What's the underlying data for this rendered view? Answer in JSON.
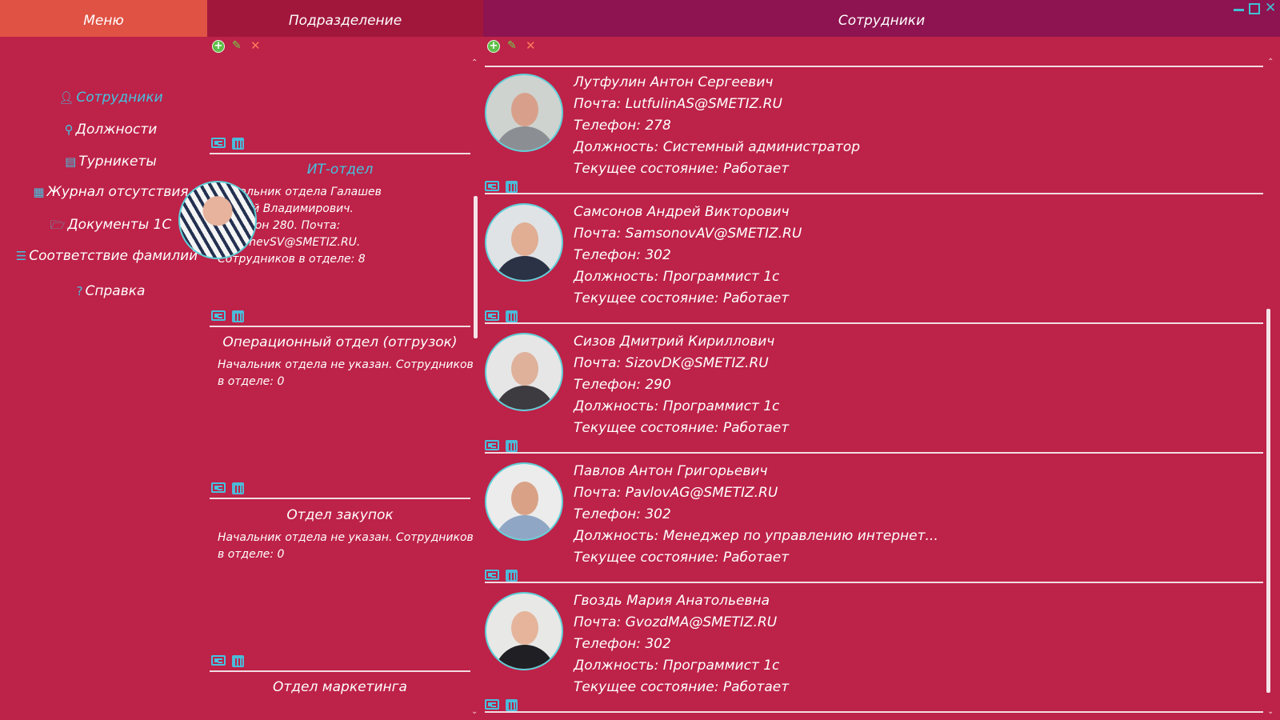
{
  "header": {
    "menu_title": "Меню",
    "dept_title": "Подразделение",
    "emp_title": "Сотрудники"
  },
  "menu": {
    "items": [
      {
        "label": "Сотрудники",
        "icon": "user-icon",
        "active": true
      },
      {
        "label": "Должности",
        "icon": "pin-icon",
        "active": false
      },
      {
        "label": "Турникеты",
        "icon": "card-icon",
        "active": false
      },
      {
        "label": "Журнал отсутствия",
        "icon": "calendar-icon",
        "active": false
      },
      {
        "label": "Документы 1С",
        "icon": "folder-open-icon",
        "active": false
      },
      {
        "label": "Соответствие фамилий",
        "icon": "list-indent-icon",
        "active": false
      },
      {
        "label": "Справка",
        "icon": "question-icon",
        "active": false
      }
    ]
  },
  "departments": [
    {
      "title": "ИТ-отдел",
      "active": true,
      "info": [
        "Начальник отдела Галашев",
        "Сергей Владимирович.",
        "Телефон 280. Почта:",
        "GalashevSV@SMETIZ.RU.",
        "Сотрудников в отделе: 8"
      ]
    },
    {
      "title": "Операционный отдел (отгрузок)",
      "active": false,
      "info": [
        "Начальник отдела не указан. Сотрудников",
        "в отделе: 0"
      ]
    },
    {
      "title": "Отдел закупок",
      "active": false,
      "info": [
        "Начальник отдела не указан. Сотрудников",
        "в отделе: 0"
      ]
    },
    {
      "title": "Отдел маркетинга",
      "active": false,
      "info": []
    }
  ],
  "employees": [
    {
      "name": "Лутфулин Антон Сергеевич",
      "email": "Почта: LutfulinAS@SMETIZ.RU",
      "phone": "Телефон: 278",
      "position": "Должность: Системный администратор",
      "status": "Текущее состояние: Работает",
      "bg": "#cfd3d0",
      "face": "#d8a08a",
      "shirt": "#8b8f93"
    },
    {
      "name": "Самсонов Андрей Викторович",
      "email": "Почта: SamsonovAV@SMETIZ.RU",
      "phone": "Телефон: 302",
      "position": "Должность: Программист 1с",
      "status": "Текущее состояние: Работает",
      "bg": "#dfe3e6",
      "face": "#e1ad93",
      "shirt": "#2b3245"
    },
    {
      "name": "Сизов Дмитрий Кириллович",
      "email": "Почта: SizovDK@SMETIZ.RU",
      "phone": "Телефон: 290",
      "position": "Должность: Программист 1с",
      "status": "Текущее состояние: Работает",
      "bg": "#e6e6e6",
      "face": "#dfb09a",
      "shirt": "#3d3a40"
    },
    {
      "name": "Павлов Антон Григорьевич",
      "email": "Почта: PavlovAG@SMETIZ.RU",
      "phone": "Телефон: 302",
      "position": "Должность: Менеджер по управлению интернет...",
      "status": "Текущее состояние: Работает",
      "bg": "#ececec",
      "face": "#d9a286",
      "shirt": "#8fa6c4"
    },
    {
      "name": "Гвоздь Мария Анатольевна",
      "email": "Почта: GvozdMA@SMETIZ.RU",
      "phone": "Телефон: 302",
      "position": "Должность: Программист 1с",
      "status": "Текущее состояние: Работает",
      "bg": "#e8e8e6",
      "face": "#e5b49a",
      "shirt": "#1f1f24"
    }
  ],
  "colors": {
    "background": "#bd2248",
    "menu_header": "#e05244",
    "dept_header": "#a1173c",
    "emp_header": "#8d1450",
    "accent": "#45c3e0"
  }
}
